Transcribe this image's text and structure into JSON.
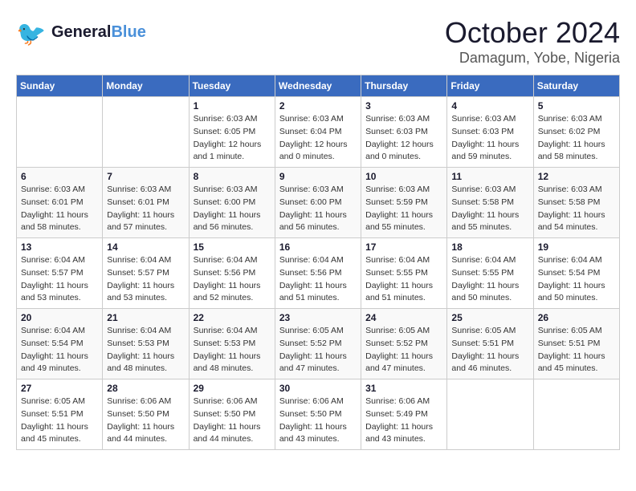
{
  "logo": {
    "general": "General",
    "blue": "Blue"
  },
  "title": "October 2024",
  "location": "Damagum, Yobe, Nigeria",
  "days_of_week": [
    "Sunday",
    "Monday",
    "Tuesday",
    "Wednesday",
    "Thursday",
    "Friday",
    "Saturday"
  ],
  "weeks": [
    [
      {
        "day": "",
        "detail": ""
      },
      {
        "day": "",
        "detail": ""
      },
      {
        "day": "1",
        "detail": "Sunrise: 6:03 AM\nSunset: 6:05 PM\nDaylight: 12 hours\nand 1 minute."
      },
      {
        "day": "2",
        "detail": "Sunrise: 6:03 AM\nSunset: 6:04 PM\nDaylight: 12 hours\nand 0 minutes."
      },
      {
        "day": "3",
        "detail": "Sunrise: 6:03 AM\nSunset: 6:03 PM\nDaylight: 12 hours\nand 0 minutes."
      },
      {
        "day": "4",
        "detail": "Sunrise: 6:03 AM\nSunset: 6:03 PM\nDaylight: 11 hours\nand 59 minutes."
      },
      {
        "day": "5",
        "detail": "Sunrise: 6:03 AM\nSunset: 6:02 PM\nDaylight: 11 hours\nand 58 minutes."
      }
    ],
    [
      {
        "day": "6",
        "detail": "Sunrise: 6:03 AM\nSunset: 6:01 PM\nDaylight: 11 hours\nand 58 minutes."
      },
      {
        "day": "7",
        "detail": "Sunrise: 6:03 AM\nSunset: 6:01 PM\nDaylight: 11 hours\nand 57 minutes."
      },
      {
        "day": "8",
        "detail": "Sunrise: 6:03 AM\nSunset: 6:00 PM\nDaylight: 11 hours\nand 56 minutes."
      },
      {
        "day": "9",
        "detail": "Sunrise: 6:03 AM\nSunset: 6:00 PM\nDaylight: 11 hours\nand 56 minutes."
      },
      {
        "day": "10",
        "detail": "Sunrise: 6:03 AM\nSunset: 5:59 PM\nDaylight: 11 hours\nand 55 minutes."
      },
      {
        "day": "11",
        "detail": "Sunrise: 6:03 AM\nSunset: 5:58 PM\nDaylight: 11 hours\nand 55 minutes."
      },
      {
        "day": "12",
        "detail": "Sunrise: 6:03 AM\nSunset: 5:58 PM\nDaylight: 11 hours\nand 54 minutes."
      }
    ],
    [
      {
        "day": "13",
        "detail": "Sunrise: 6:04 AM\nSunset: 5:57 PM\nDaylight: 11 hours\nand 53 minutes."
      },
      {
        "day": "14",
        "detail": "Sunrise: 6:04 AM\nSunset: 5:57 PM\nDaylight: 11 hours\nand 53 minutes."
      },
      {
        "day": "15",
        "detail": "Sunrise: 6:04 AM\nSunset: 5:56 PM\nDaylight: 11 hours\nand 52 minutes."
      },
      {
        "day": "16",
        "detail": "Sunrise: 6:04 AM\nSunset: 5:56 PM\nDaylight: 11 hours\nand 51 minutes."
      },
      {
        "day": "17",
        "detail": "Sunrise: 6:04 AM\nSunset: 5:55 PM\nDaylight: 11 hours\nand 51 minutes."
      },
      {
        "day": "18",
        "detail": "Sunrise: 6:04 AM\nSunset: 5:55 PM\nDaylight: 11 hours\nand 50 minutes."
      },
      {
        "day": "19",
        "detail": "Sunrise: 6:04 AM\nSunset: 5:54 PM\nDaylight: 11 hours\nand 50 minutes."
      }
    ],
    [
      {
        "day": "20",
        "detail": "Sunrise: 6:04 AM\nSunset: 5:54 PM\nDaylight: 11 hours\nand 49 minutes."
      },
      {
        "day": "21",
        "detail": "Sunrise: 6:04 AM\nSunset: 5:53 PM\nDaylight: 11 hours\nand 48 minutes."
      },
      {
        "day": "22",
        "detail": "Sunrise: 6:04 AM\nSunset: 5:53 PM\nDaylight: 11 hours\nand 48 minutes."
      },
      {
        "day": "23",
        "detail": "Sunrise: 6:05 AM\nSunset: 5:52 PM\nDaylight: 11 hours\nand 47 minutes."
      },
      {
        "day": "24",
        "detail": "Sunrise: 6:05 AM\nSunset: 5:52 PM\nDaylight: 11 hours\nand 47 minutes."
      },
      {
        "day": "25",
        "detail": "Sunrise: 6:05 AM\nSunset: 5:51 PM\nDaylight: 11 hours\nand 46 minutes."
      },
      {
        "day": "26",
        "detail": "Sunrise: 6:05 AM\nSunset: 5:51 PM\nDaylight: 11 hours\nand 45 minutes."
      }
    ],
    [
      {
        "day": "27",
        "detail": "Sunrise: 6:05 AM\nSunset: 5:51 PM\nDaylight: 11 hours\nand 45 minutes."
      },
      {
        "day": "28",
        "detail": "Sunrise: 6:06 AM\nSunset: 5:50 PM\nDaylight: 11 hours\nand 44 minutes."
      },
      {
        "day": "29",
        "detail": "Sunrise: 6:06 AM\nSunset: 5:50 PM\nDaylight: 11 hours\nand 44 minutes."
      },
      {
        "day": "30",
        "detail": "Sunrise: 6:06 AM\nSunset: 5:50 PM\nDaylight: 11 hours\nand 43 minutes."
      },
      {
        "day": "31",
        "detail": "Sunrise: 6:06 AM\nSunset: 5:49 PM\nDaylight: 11 hours\nand 43 minutes."
      },
      {
        "day": "",
        "detail": ""
      },
      {
        "day": "",
        "detail": ""
      }
    ]
  ]
}
